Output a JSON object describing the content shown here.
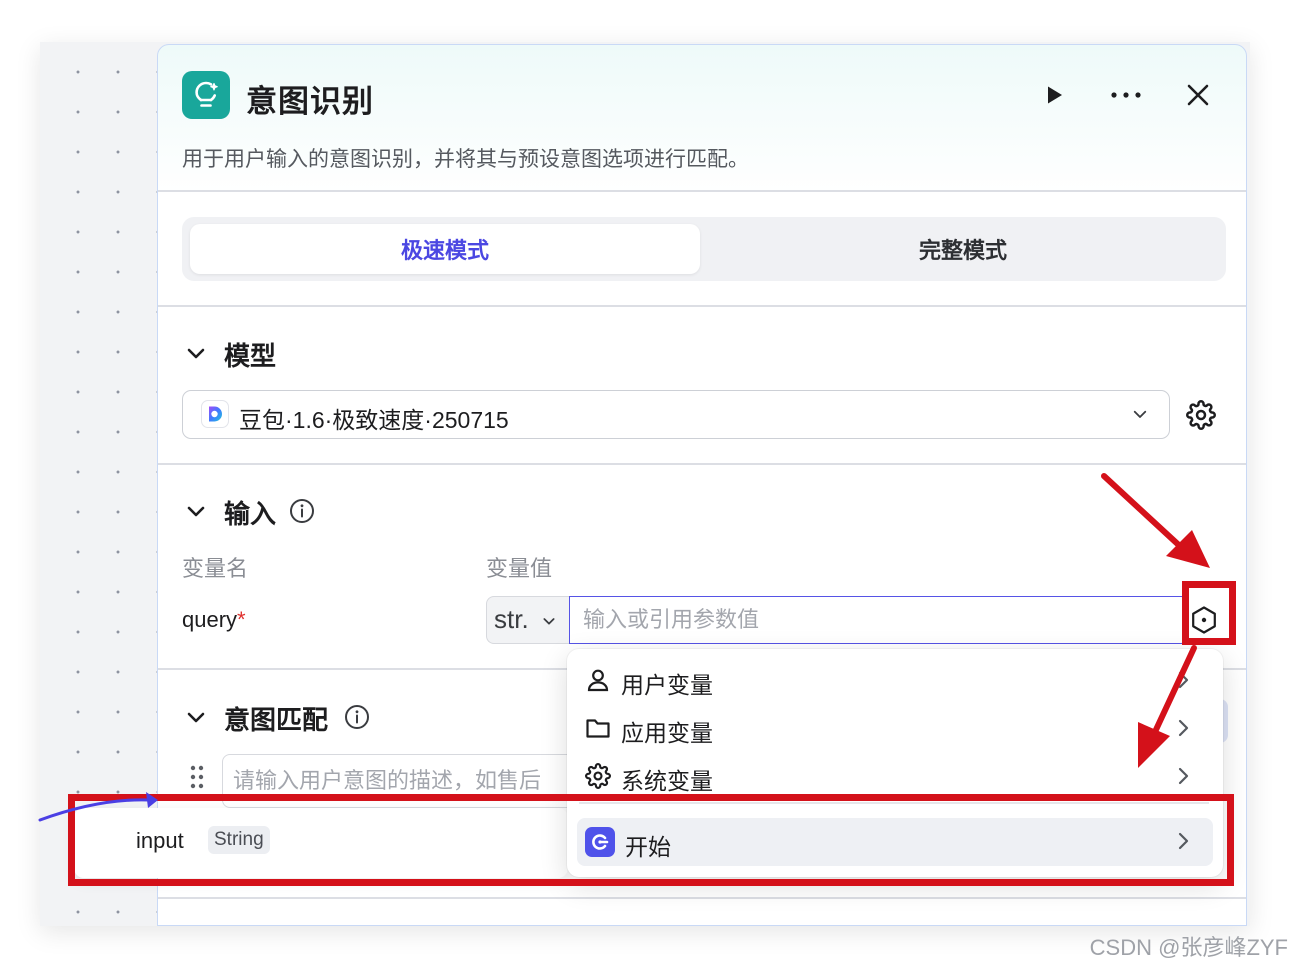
{
  "node": {
    "title": "意图识别",
    "description": "用于用户输入的意图识别，并将其与预设意图选项进行匹配。",
    "icon": "lightbulb-sparkle-icon",
    "actions": [
      "play-icon",
      "more-dots-icon",
      "close-icon"
    ]
  },
  "mode_tabs": {
    "active": "极速模式",
    "items": [
      "极速模式",
      "完整模式"
    ]
  },
  "model_section": {
    "title": "模型",
    "selected_model": "豆包·1.6·极致速度·250715"
  },
  "input_section": {
    "title": "输入",
    "col_name": "变量名",
    "col_value": "变量值",
    "variable": {
      "name": "query",
      "required_mark": "*",
      "type": "str.",
      "value_placeholder": "输入或引用参数值"
    }
  },
  "intent_section": {
    "title": "意图匹配",
    "placeholder": "请输入用户意图的描述，如售后"
  },
  "variable_menu": {
    "items": [
      {
        "label": "用户变量",
        "icon": "user-icon"
      },
      {
        "label": "应用变量",
        "icon": "folder-icon"
      },
      {
        "label": "系统变量",
        "icon": "gear-icon"
      }
    ],
    "start": {
      "label": "开始",
      "icon": "start-node-icon"
    }
  },
  "output_card": {
    "name": "input",
    "type": "String"
  },
  "colors": {
    "accent": "#4b47e2",
    "node_icon": "#19a79b",
    "annotation": "#d4111a"
  },
  "watermark": "CSDN @张彦峰ZYF"
}
